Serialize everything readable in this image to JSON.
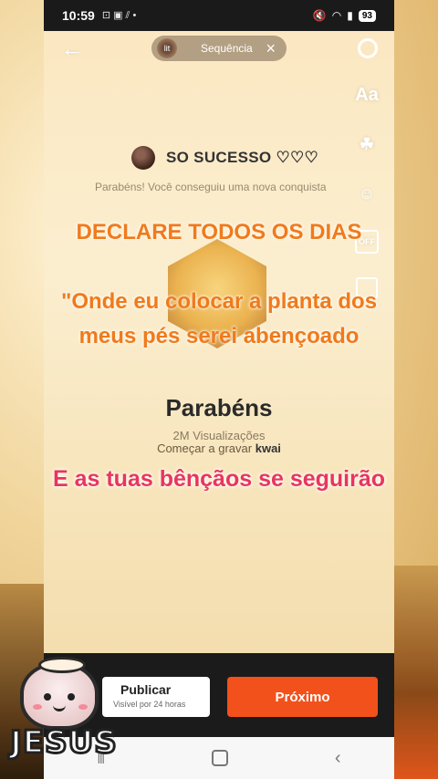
{
  "status_bar": {
    "time": "10:59",
    "icons_left": "⊡ ▣ ⫽ •",
    "battery": "93"
  },
  "top_bar": {
    "pill_label": "Sequência",
    "pill_thumb_text": "lit"
  },
  "tools": {
    "text_tool": "Aa",
    "off_tool": "OFF"
  },
  "post": {
    "username": "SO SUCESSO ♡♡♡",
    "achievement_text": "Parabéns! Você conseguiu uma nova conquista",
    "title": "Parabéns",
    "views": "2M Visualizações",
    "record_text": "Começar a gravar",
    "brand": "kwai"
  },
  "overlays": {
    "line1": "DECLARE TODOS OS DIAS",
    "line2": "\"Onde eu colocar a planta dos meus pés serei abençoado",
    "line3": "E as tuas bênçãos se seguirão"
  },
  "actions": {
    "publish_label": "Publicar",
    "publish_sub": "Visível por 24 horas",
    "next_label": "Próximo"
  },
  "sticker": {
    "text": "JESUS"
  },
  "colors": {
    "accent": "#f2511c",
    "overlay_orange": "#f07a1c",
    "overlay_pink": "#e8355e"
  }
}
